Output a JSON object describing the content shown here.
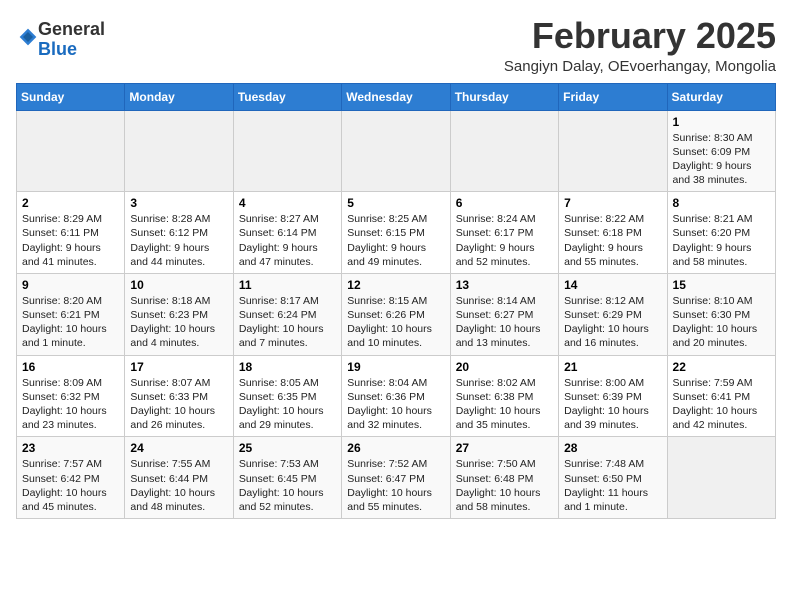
{
  "logo": {
    "general": "General",
    "blue": "Blue"
  },
  "title": "February 2025",
  "subtitle": "Sangiyn Dalay, OEvoerhangay, Mongolia",
  "days_header": [
    "Sunday",
    "Monday",
    "Tuesday",
    "Wednesday",
    "Thursday",
    "Friday",
    "Saturday"
  ],
  "weeks": [
    [
      {
        "day": "",
        "info": ""
      },
      {
        "day": "",
        "info": ""
      },
      {
        "day": "",
        "info": ""
      },
      {
        "day": "",
        "info": ""
      },
      {
        "day": "",
        "info": ""
      },
      {
        "day": "",
        "info": ""
      },
      {
        "day": "1",
        "info": "Sunrise: 8:30 AM\nSunset: 6:09 PM\nDaylight: 9 hours and 38 minutes."
      }
    ],
    [
      {
        "day": "2",
        "info": "Sunrise: 8:29 AM\nSunset: 6:11 PM\nDaylight: 9 hours and 41 minutes."
      },
      {
        "day": "3",
        "info": "Sunrise: 8:28 AM\nSunset: 6:12 PM\nDaylight: 9 hours and 44 minutes."
      },
      {
        "day": "4",
        "info": "Sunrise: 8:27 AM\nSunset: 6:14 PM\nDaylight: 9 hours and 47 minutes."
      },
      {
        "day": "5",
        "info": "Sunrise: 8:25 AM\nSunset: 6:15 PM\nDaylight: 9 hours and 49 minutes."
      },
      {
        "day": "6",
        "info": "Sunrise: 8:24 AM\nSunset: 6:17 PM\nDaylight: 9 hours and 52 minutes."
      },
      {
        "day": "7",
        "info": "Sunrise: 8:22 AM\nSunset: 6:18 PM\nDaylight: 9 hours and 55 minutes."
      },
      {
        "day": "8",
        "info": "Sunrise: 8:21 AM\nSunset: 6:20 PM\nDaylight: 9 hours and 58 minutes."
      }
    ],
    [
      {
        "day": "9",
        "info": "Sunrise: 8:20 AM\nSunset: 6:21 PM\nDaylight: 10 hours and 1 minute."
      },
      {
        "day": "10",
        "info": "Sunrise: 8:18 AM\nSunset: 6:23 PM\nDaylight: 10 hours and 4 minutes."
      },
      {
        "day": "11",
        "info": "Sunrise: 8:17 AM\nSunset: 6:24 PM\nDaylight: 10 hours and 7 minutes."
      },
      {
        "day": "12",
        "info": "Sunrise: 8:15 AM\nSunset: 6:26 PM\nDaylight: 10 hours and 10 minutes."
      },
      {
        "day": "13",
        "info": "Sunrise: 8:14 AM\nSunset: 6:27 PM\nDaylight: 10 hours and 13 minutes."
      },
      {
        "day": "14",
        "info": "Sunrise: 8:12 AM\nSunset: 6:29 PM\nDaylight: 10 hours and 16 minutes."
      },
      {
        "day": "15",
        "info": "Sunrise: 8:10 AM\nSunset: 6:30 PM\nDaylight: 10 hours and 20 minutes."
      }
    ],
    [
      {
        "day": "16",
        "info": "Sunrise: 8:09 AM\nSunset: 6:32 PM\nDaylight: 10 hours and 23 minutes."
      },
      {
        "day": "17",
        "info": "Sunrise: 8:07 AM\nSunset: 6:33 PM\nDaylight: 10 hours and 26 minutes."
      },
      {
        "day": "18",
        "info": "Sunrise: 8:05 AM\nSunset: 6:35 PM\nDaylight: 10 hours and 29 minutes."
      },
      {
        "day": "19",
        "info": "Sunrise: 8:04 AM\nSunset: 6:36 PM\nDaylight: 10 hours and 32 minutes."
      },
      {
        "day": "20",
        "info": "Sunrise: 8:02 AM\nSunset: 6:38 PM\nDaylight: 10 hours and 35 minutes."
      },
      {
        "day": "21",
        "info": "Sunrise: 8:00 AM\nSunset: 6:39 PM\nDaylight: 10 hours and 39 minutes."
      },
      {
        "day": "22",
        "info": "Sunrise: 7:59 AM\nSunset: 6:41 PM\nDaylight: 10 hours and 42 minutes."
      }
    ],
    [
      {
        "day": "23",
        "info": "Sunrise: 7:57 AM\nSunset: 6:42 PM\nDaylight: 10 hours and 45 minutes."
      },
      {
        "day": "24",
        "info": "Sunrise: 7:55 AM\nSunset: 6:44 PM\nDaylight: 10 hours and 48 minutes."
      },
      {
        "day": "25",
        "info": "Sunrise: 7:53 AM\nSunset: 6:45 PM\nDaylight: 10 hours and 52 minutes."
      },
      {
        "day": "26",
        "info": "Sunrise: 7:52 AM\nSunset: 6:47 PM\nDaylight: 10 hours and 55 minutes."
      },
      {
        "day": "27",
        "info": "Sunrise: 7:50 AM\nSunset: 6:48 PM\nDaylight: 10 hours and 58 minutes."
      },
      {
        "day": "28",
        "info": "Sunrise: 7:48 AM\nSunset: 6:50 PM\nDaylight: 11 hours and 1 minute."
      },
      {
        "day": "",
        "info": ""
      }
    ]
  ]
}
